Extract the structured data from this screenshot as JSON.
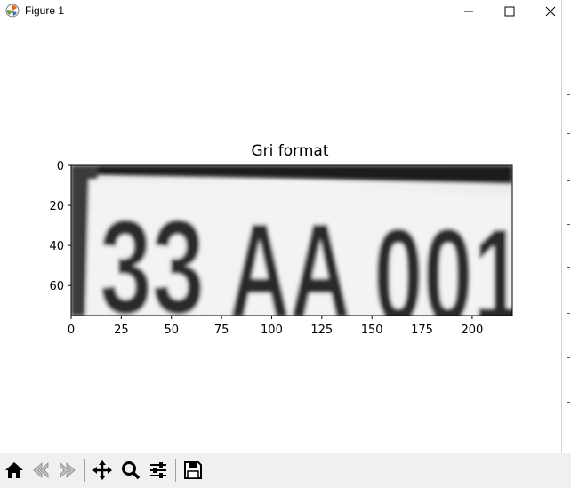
{
  "window": {
    "title": "Figure 1",
    "icons": {
      "app": "matplotlib-icon",
      "minimize": "minimize-icon",
      "maximize": "maximize-icon",
      "close": "close-icon"
    }
  },
  "figure": {
    "title": "Gri format",
    "image_description_text": "33 AA 001",
    "x_ticks": [
      "0",
      "25",
      "50",
      "75",
      "100",
      "125",
      "150",
      "175",
      "200"
    ],
    "y_ticks": [
      "0",
      "20",
      "40",
      "60"
    ],
    "xlim": [
      0,
      220
    ],
    "ylim": [
      75,
      0
    ]
  },
  "toolbar": {
    "buttons": [
      {
        "name": "home-icon"
      },
      {
        "name": "back-icon"
      },
      {
        "name": "forward-icon"
      },
      {
        "name": "pan-icon"
      },
      {
        "name": "zoom-icon"
      },
      {
        "name": "subplots-icon"
      },
      {
        "name": "save-icon"
      }
    ]
  },
  "colors": {
    "toolbar_bg": "#f0f0f0",
    "image_dark": "#2b2b2b",
    "image_light": "#f2f2f2"
  }
}
